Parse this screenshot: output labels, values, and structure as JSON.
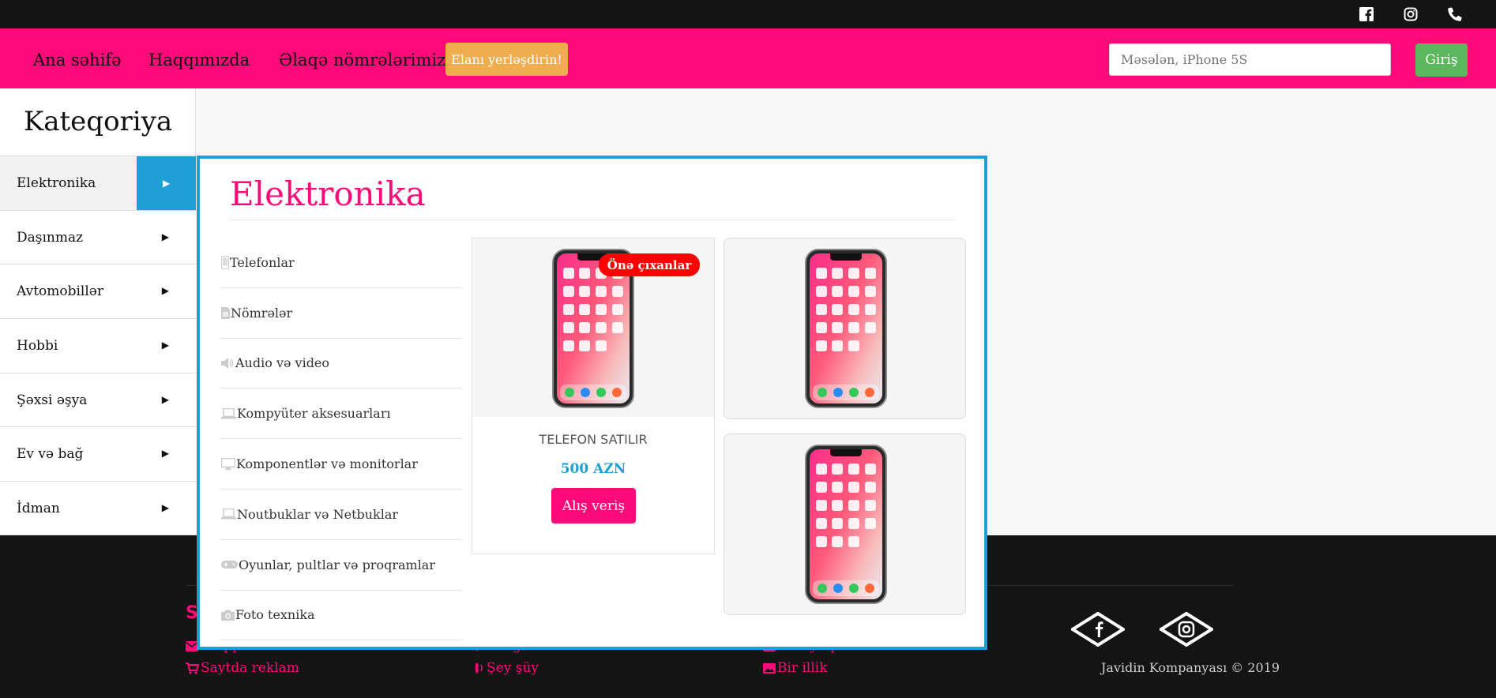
{
  "topbar": {
    "icons": [
      "facebook-icon",
      "instagram-icon",
      "phone-icon"
    ]
  },
  "nav": {
    "links": [
      "Ana səhifə",
      "Haqqımızda",
      "Əlaqə nömrələrimiz"
    ],
    "post_button": "Elanı yerləşdirin!",
    "search_placeholder": "Məsələn, iPhone 5S",
    "login_button": "Giriş"
  },
  "sidebar": {
    "title": "Kateqoriya",
    "items": [
      "Elektronika",
      "Daşınmaz",
      "Avtomobillər",
      "Hobbi",
      "Şəxsi əşya",
      "Ev və bağ",
      "İdman"
    ],
    "active_index": 0
  },
  "mega": {
    "title": "Elektronika",
    "subcategories": [
      {
        "label": "Telefonlar",
        "icon": "mobile-icon"
      },
      {
        "label": "Nömrələr",
        "icon": "sim-card-icon"
      },
      {
        "label": "Audio və video",
        "icon": "volume-icon"
      },
      {
        "label": "Kompyüter aksesuarları",
        "icon": "laptop-icon"
      },
      {
        "label": "Komponentlər və monitorlar",
        "icon": "desktop-icon"
      },
      {
        "label": "Noutbuklar və Netbuklar",
        "icon": "laptop-icon"
      },
      {
        "label": "Oyunlar, pultlar və proqramlar",
        "icon": "gamepad-icon"
      },
      {
        "label": "Foto texnika",
        "icon": "camera-icon"
      }
    ],
    "product": {
      "badge": "Önə çıxanlar",
      "name": "TELEFON SATILIR",
      "price": "500 AZN",
      "buy_button": "Alış veriş"
    }
  },
  "footer": {
    "col1": [
      "Haqqımızda",
      "Saytda reklam"
    ],
    "col2": [
      "Zəng elə",
      "Şey şüy"
    ],
    "col3": [
      "Bir aylıq",
      "Bir illik"
    ],
    "copyright": "Javidin Kompanyası © 2019",
    "colors": {
      "accent": "#ff0a78",
      "background": "#141414"
    }
  },
  "colors": {
    "brand_pink": "#ff0a78",
    "accent_blue": "#1e9fd5",
    "warning": "#f0ad4e",
    "success": "#5cb85c",
    "badge_red": "#ff0000"
  }
}
